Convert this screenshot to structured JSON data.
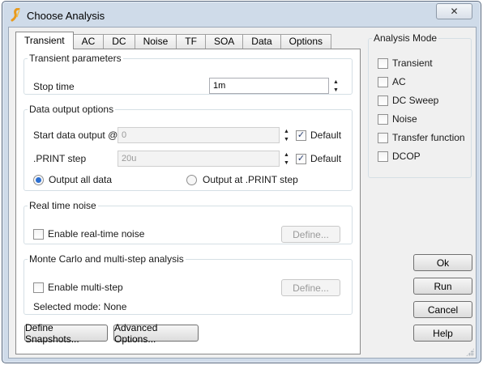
{
  "window": {
    "title": "Choose Analysis",
    "close_glyph": "✕"
  },
  "tabs": [
    "Transient",
    "AC",
    "DC",
    "Noise",
    "TF",
    "SOA",
    "Data",
    "Options"
  ],
  "active_tab": "Transient",
  "transient_params": {
    "legend": "Transient parameters",
    "stop_time_label": "Stop time",
    "stop_time_value": "1m"
  },
  "data_output": {
    "legend": "Data output options",
    "start_label": "Start data output @",
    "start_value": "0",
    "start_default_label": "Default",
    "start_default_checked": true,
    "print_step_label": ".PRINT step",
    "print_step_value": "20u",
    "print_default_label": "Default",
    "print_default_checked": true,
    "output_all_label": "Output all data",
    "output_all_selected": true,
    "output_print_label": "Output at .PRINT step",
    "output_print_selected": false
  },
  "realtime_noise": {
    "legend": "Real time noise",
    "enable_label": "Enable real-time noise",
    "enable_checked": false,
    "define_label": "Define..."
  },
  "monte_carlo": {
    "legend": "Monte Carlo and multi-step analysis",
    "enable_label": "Enable multi-step",
    "enable_checked": false,
    "define_label": "Define...",
    "selected_mode_text": "Selected mode: None"
  },
  "bottom_buttons": {
    "define_snapshots": "Define Snapshots...",
    "advanced_options": "Advanced Options..."
  },
  "analysis_mode": {
    "legend": "Analysis Mode",
    "items": [
      {
        "label": "Transient",
        "checked": false
      },
      {
        "label": "AC",
        "checked": false
      },
      {
        "label": "DC Sweep",
        "checked": false
      },
      {
        "label": "Noise",
        "checked": false
      },
      {
        "label": "Transfer function",
        "checked": false
      },
      {
        "label": "DCOP",
        "checked": false
      }
    ]
  },
  "actions": {
    "ok": "Ok",
    "run": "Run",
    "cancel": "Cancel",
    "help": "Help"
  },
  "icons": {
    "app": "simetrix-logo-icon",
    "spin_up": "▲",
    "spin_down": "▼",
    "check": "✓"
  },
  "colors": {
    "logo": "#e89a1c",
    "title_bar": "#cfdbe9",
    "radio_selected": "#2c6fd1"
  }
}
